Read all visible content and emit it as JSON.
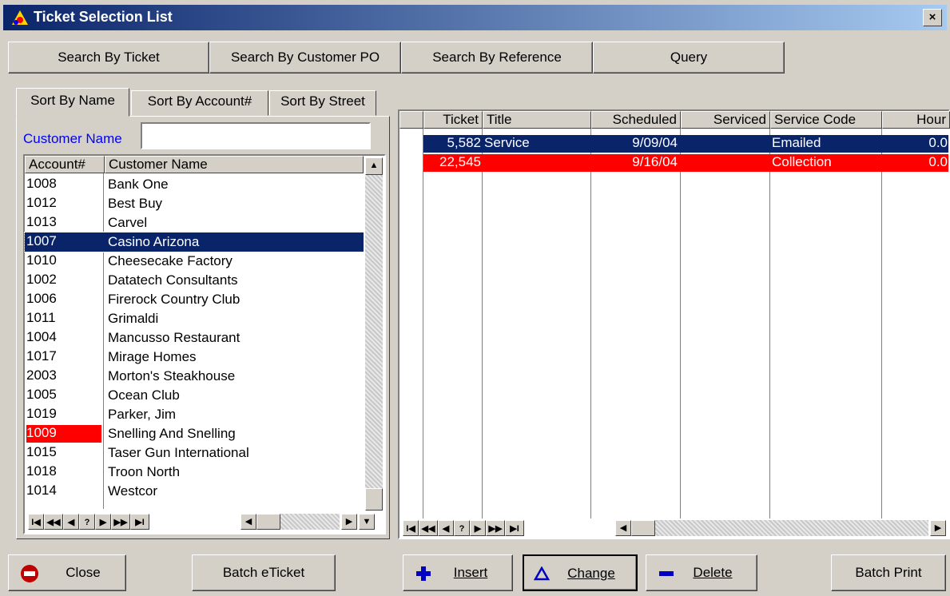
{
  "window": {
    "title": "Ticket Selection List",
    "close_glyph": "×"
  },
  "search_buttons": [
    "Search By Ticket",
    "Search By Customer PO",
    "Search By Reference",
    "Query"
  ],
  "tabs": [
    "Sort By Name",
    "Sort By Account#",
    "Sort By Street"
  ],
  "customer_filter": {
    "label": "Customer Name",
    "value": ""
  },
  "customer_list": {
    "columns": [
      "Account#",
      "Customer Name"
    ],
    "rows": [
      {
        "account": "1008",
        "name": "Bank One"
      },
      {
        "account": "1012",
        "name": "Best Buy"
      },
      {
        "account": "1013",
        "name": "Carvel"
      },
      {
        "account": "1007",
        "name": "Casino Arizona",
        "selected": true
      },
      {
        "account": "1010",
        "name": "Cheesecake Factory"
      },
      {
        "account": "1002",
        "name": "Datatech Consultants"
      },
      {
        "account": "1006",
        "name": "Firerock Country Club"
      },
      {
        "account": "1011",
        "name": "Grimaldi"
      },
      {
        "account": "1004",
        "name": "Mancusso Restaurant"
      },
      {
        "account": "1017",
        "name": "Mirage Homes"
      },
      {
        "account": "2003",
        "name": "Morton's Steakhouse"
      },
      {
        "account": "1005",
        "name": "Ocean Club"
      },
      {
        "account": "1019",
        "name": "Parker, Jim"
      },
      {
        "account": "1009",
        "name": "Snelling And Snelling",
        "flagged": true
      },
      {
        "account": "1015",
        "name": "Taser Gun International"
      },
      {
        "account": "1018",
        "name": "Troon North"
      },
      {
        "account": "1014",
        "name": "Westcor"
      }
    ]
  },
  "ticket_grid": {
    "columns": [
      "Ticket",
      "Title",
      "Scheduled",
      "Serviced",
      "Service Code",
      "Hour"
    ],
    "rows": [
      {
        "ticket": "5,582",
        "title": "Service",
        "scheduled": "9/09/04",
        "serviced": "",
        "service_code": "Emailed",
        "hours": "0.0",
        "style": "selected"
      },
      {
        "ticket": "22,545",
        "title": "",
        "scheduled": "9/16/04",
        "serviced": "",
        "service_code": "Collection",
        "hours": "0.0",
        "style": "flagged"
      }
    ]
  },
  "navigator": {
    "buttons": [
      "I◀",
      "◀◀",
      "◀",
      "?",
      "▶",
      "▶▶",
      "▶I"
    ]
  },
  "bottom_buttons": {
    "close": "Close",
    "batch_eticket": "Batch eTicket",
    "insert": "Insert",
    "change": "Change",
    "delete": "Delete",
    "batch_print": "Batch Print"
  },
  "colors": {
    "selection": "#0a246a",
    "flag": "#ff0000"
  }
}
